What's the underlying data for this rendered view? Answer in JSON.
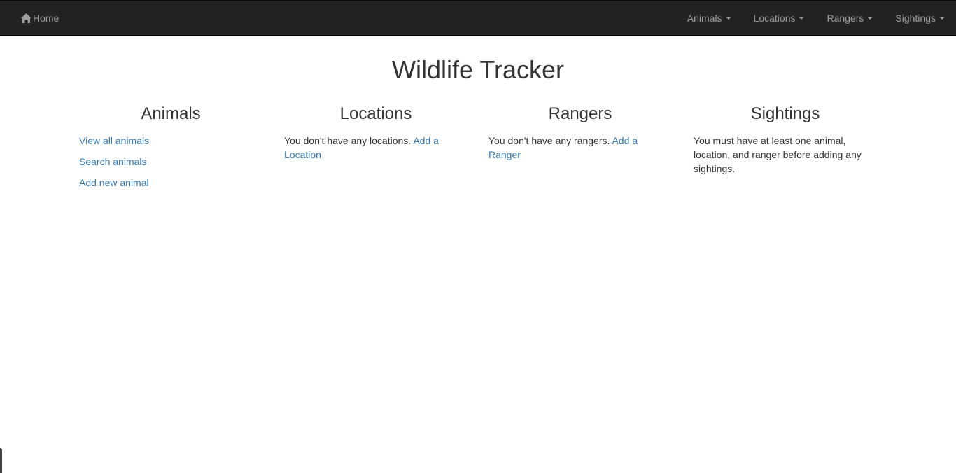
{
  "navbar": {
    "home_label": "Home",
    "icon": "home-icon",
    "menus": [
      {
        "label": "Animals"
      },
      {
        "label": "Locations"
      },
      {
        "label": "Rangers"
      },
      {
        "label": "Sightings"
      }
    ]
  },
  "page": {
    "title": "Wildlife Tracker"
  },
  "animals": {
    "heading": "Animals",
    "links": [
      "View all animals",
      "Search animals",
      "Add new animal"
    ]
  },
  "locations": {
    "heading": "Locations",
    "message": "You don't have any locations.",
    "link": "Add a Location"
  },
  "rangers": {
    "heading": "Rangers",
    "message": "You don't have any rangers.",
    "link": "Add a Ranger"
  },
  "sightings": {
    "heading": "Sightings",
    "message": "You must have at least one animal, location, and ranger before adding any sightings."
  },
  "colors": {
    "navbar_bg": "#222222",
    "nav_text": "#9d9d9d",
    "link": "#337ab7",
    "text": "#333333"
  }
}
